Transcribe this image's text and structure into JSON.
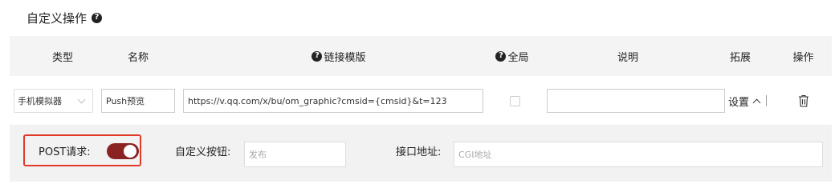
{
  "section": {
    "title": "自定义操作",
    "help_icon": "question-circle-icon"
  },
  "table": {
    "headers": {
      "type": "类型",
      "name": "名称",
      "template": "链接模版",
      "global": "全局",
      "desc": "说明",
      "extend": "拓展",
      "action": "操作"
    }
  },
  "row": {
    "type_value": "手机模拟器",
    "name_value": "Push预览",
    "template_value": "https://v.qq.com/x/bu/om_graphic?cmsid={cmsid}&t=123",
    "global_checked": false,
    "desc_value": "",
    "setting_label": "设置",
    "delete_icon": "trash-icon"
  },
  "panel": {
    "post_label": "POST请求:",
    "post_enabled": true,
    "toggle_color": "#8c2323",
    "highlight_color": "#e03a2a",
    "button_label": "自定义按钮:",
    "button_placeholder": "发布",
    "url_label": "接口地址:",
    "url_placeholder": "CGI地址"
  }
}
